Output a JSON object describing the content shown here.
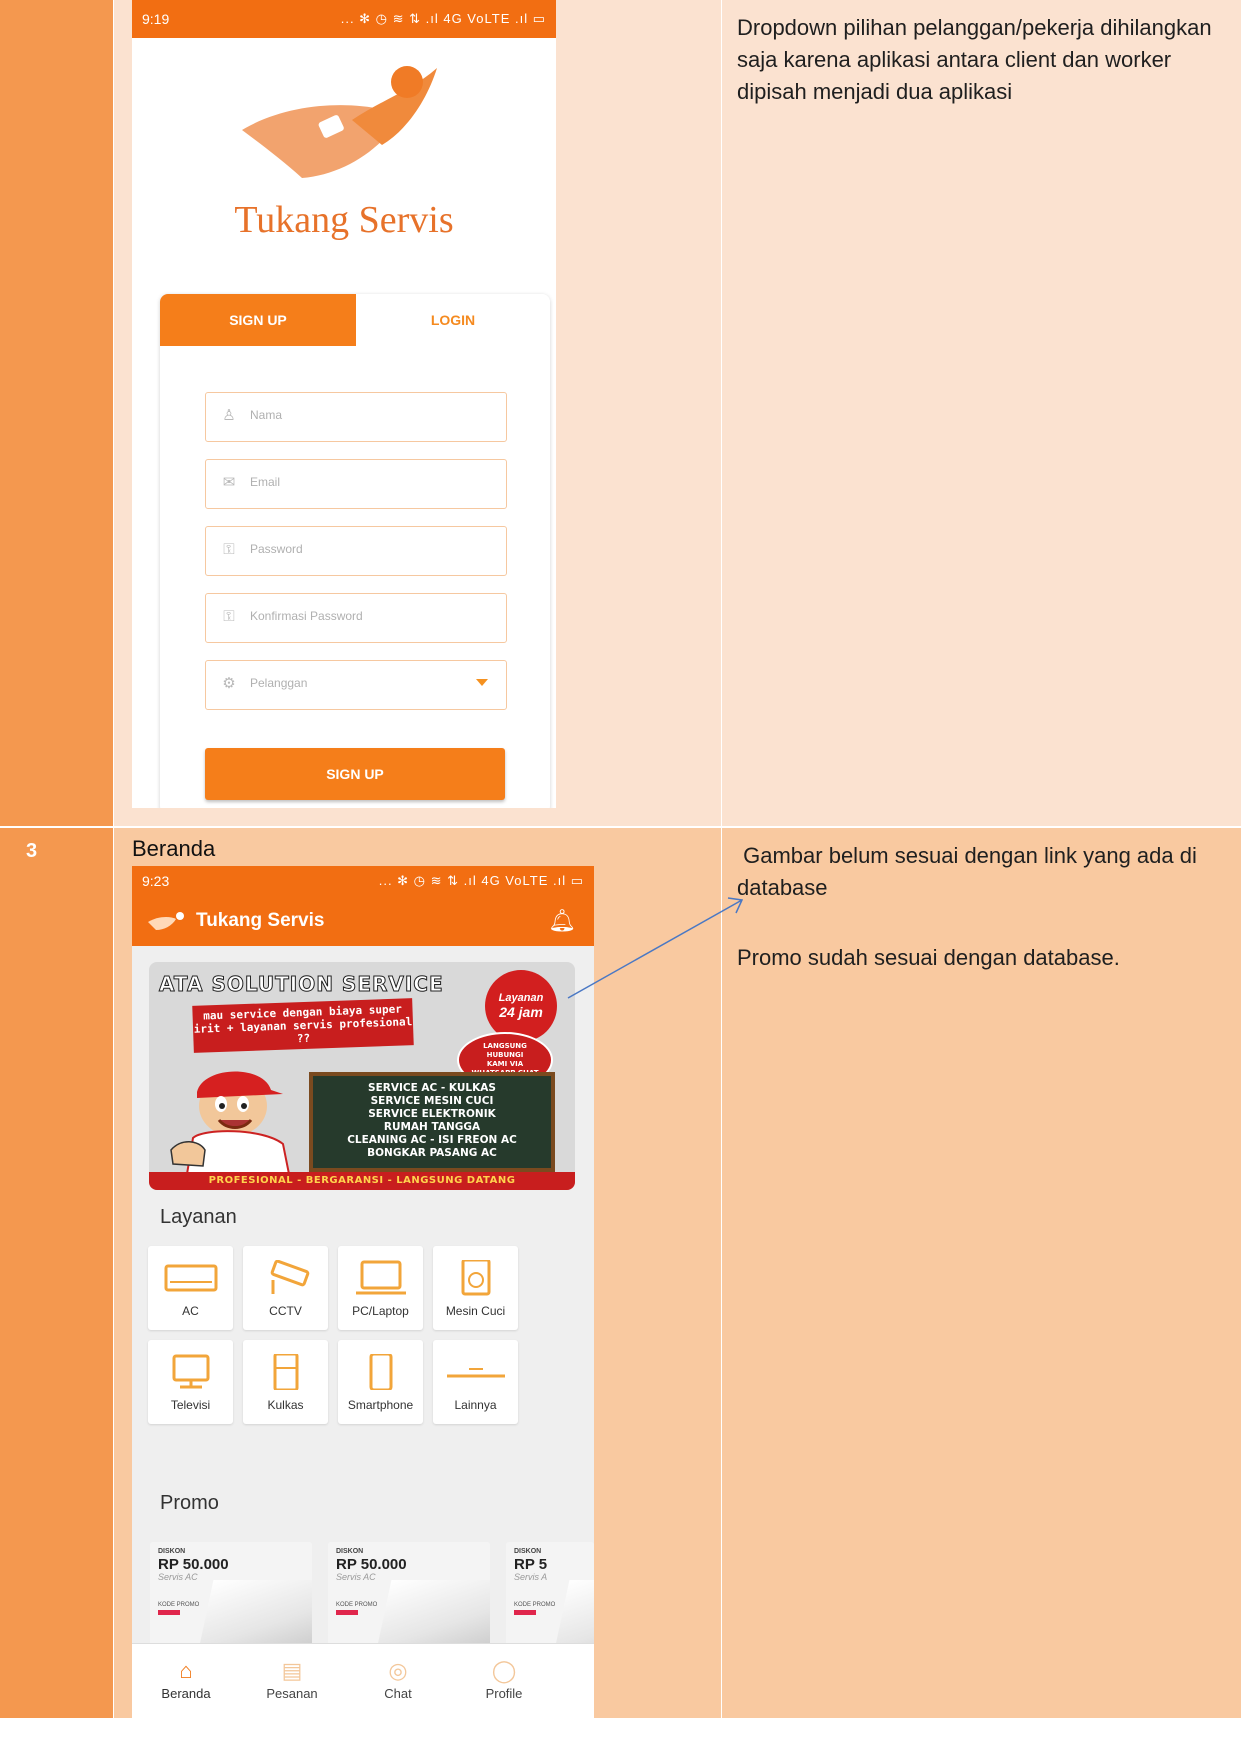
{
  "row1": {
    "number": "",
    "phone": {
      "status_time": "9:19",
      "status_icons": "... ✻ ◷ ≋ ⇅ .ıl 4G VoLTE .ıl ▭",
      "brand": "Tukang Servis",
      "tabs": {
        "signup": "SIGN UP",
        "login": "LOGIN"
      },
      "fields": [
        {
          "placeholder": "Nama",
          "icon": "person-icon"
        },
        {
          "placeholder": "Email",
          "icon": "mail-icon"
        },
        {
          "placeholder": "Password",
          "icon": "lock-icon"
        },
        {
          "placeholder": "Konfirmasi Password",
          "icon": "lock-icon"
        },
        {
          "placeholder": "Pelanggan",
          "icon": "gear-icon"
        }
      ],
      "signup_button": "SIGN UP"
    },
    "note": "Dropdown pilihan pelanggan/pekerja dihilangkan saja karena aplikasi antara client dan worker dipisah menjadi dua aplikasi"
  },
  "row2": {
    "number": "3",
    "title": "Beranda",
    "phone": {
      "status_time": "9:23",
      "status_icons": "... ✻ ◷ ≋ ⇅ .ıl 4G VoLTE .ıl ▭",
      "app_title": "Tukang Servis",
      "banner": {
        "headline": "ATA SOLUTION SERVICE",
        "subline": "mau service dengan biaya super irit + layanan servis profesional ??",
        "clock_line1": "Layanan",
        "clock_line2": "24 jam",
        "oval": [
          "LANGSUNG",
          "HUBUNGI",
          "KAMI VIA",
          "WHATSAPP CHAT"
        ],
        "board": [
          "SERVICE AC - KULKAS",
          "SERVICE MESIN CUCI",
          "SERVICE ELEKTRONIK",
          "RUMAH TANGGA",
          "CLEANING AC - ISI FREON AC",
          "BONGKAR PASANG AC"
        ],
        "strip": "PROFESIONAL - BERGARANSI - LANGSUNG DATANG"
      },
      "services_label": "Layanan",
      "services": [
        "AC",
        "CCTV",
        "PC/Laptop",
        "Mesin Cuci",
        "Televisi",
        "Kulkas",
        "Smartphone",
        "Lainnya"
      ],
      "promo_label": "Promo",
      "promos": [
        {
          "tag": "DISKON",
          "amount": "RP 50.000",
          "sub": "Servis AC",
          "code": "KODE PROMO"
        },
        {
          "tag": "DISKON",
          "amount": "RP 50.000",
          "sub": "Servis AC",
          "code": "KODE PROMO"
        },
        {
          "tag": "DISKON",
          "amount": "RP 5",
          "sub": "Servis A",
          "code": "KODE PROMO"
        }
      ],
      "nav": [
        "Beranda",
        "Pesanan",
        "Chat",
        "Profile"
      ]
    },
    "note1": " Gambar belum sesuai dengan link yang ada di database",
    "note2": "Promo sudah sesuai dengan database."
  },
  "colors": {
    "orange": "#f26e12",
    "peach": "#fbe2d0",
    "salmon": "#f9c9a0",
    "number_col": "#f4984f",
    "arrow": "#4a78c4"
  }
}
